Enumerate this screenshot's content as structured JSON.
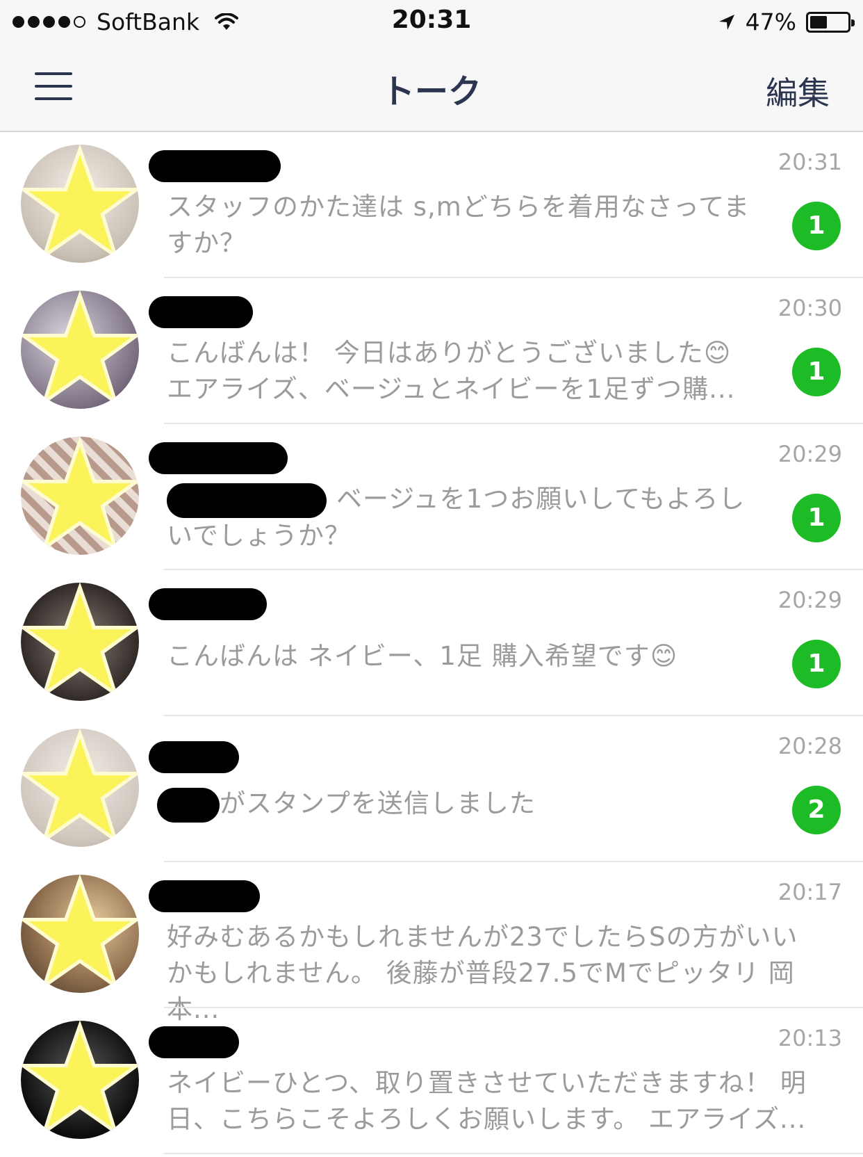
{
  "status_bar": {
    "carrier": "SoftBank",
    "time": "20:31",
    "battery": "47%",
    "battery_level": 0.47
  },
  "nav": {
    "title": "トーク",
    "edit": "編集"
  },
  "chats": [
    {
      "time": "20:31",
      "preview": "スタッフのかた達は s,mどちらを着用なさってますか？",
      "badge": "1"
    },
    {
      "time": "20:30",
      "preview": "こんばんは！ 今日はありがとうございました😊 エアライズ、ベージュとネイビーを1足ずつ購...",
      "badge": "1"
    },
    {
      "time": "20:29",
      "preview": "ベージュを1つお願いしてもよろしいでしょうか？",
      "badge": "1"
    },
    {
      "time": "20:29",
      "preview": "こんばんは ネイビー、1足 購入希望です😊",
      "badge": "1"
    },
    {
      "time": "20:28",
      "preview": "がスタンプを送信しました",
      "badge": "2"
    },
    {
      "time": "20:17",
      "preview": "好みむあるかもしれませんが23でしたらSの方がいいかもしれません。 後藤が普段27.5でMでピッタリ 岡本...",
      "badge": ""
    },
    {
      "time": "20:13",
      "preview": "ネイビーひとつ、取り置きさせていただきますね！ 明日、こちらこそよろしくお願いします。 エアライズ...",
      "badge": ""
    }
  ]
}
